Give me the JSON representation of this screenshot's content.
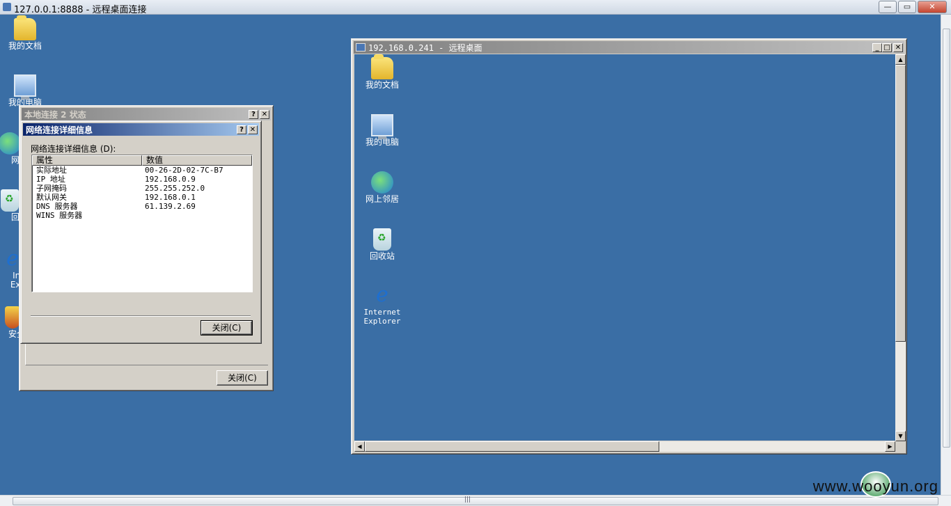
{
  "client": {
    "title": "127.0.0.1:8888 - 远程桌面连接",
    "controls": [
      "—",
      "▭",
      "✕"
    ]
  },
  "desktop_icons": [
    {
      "label": "我的文档",
      "icon": "folder-icon"
    },
    {
      "label": "我的电脑",
      "icon": "computer-icon"
    },
    {
      "label": "网",
      "icon": "network-icon"
    },
    {
      "label": "回",
      "icon": "recycle-bin-icon"
    },
    {
      "label": "Int",
      "label2": "Exp",
      "icon": "ie-icon"
    },
    {
      "label": "安全",
      "icon": "shield-icon"
    }
  ],
  "status_window": {
    "title": "本地连接 2 状态",
    "close_label": "关闭(C)"
  },
  "details_dialog": {
    "title": "网络连接详细信息",
    "group_label": "网络连接详细信息 (D):",
    "columns": [
      "属性",
      "数值"
    ],
    "rows": [
      {
        "name": "实际地址",
        "value": "00-26-2D-02-7C-B7"
      },
      {
        "name": "IP 地址",
        "value": "192.168.0.9"
      },
      {
        "name": "子网掩码",
        "value": "255.255.252.0"
      },
      {
        "name": "默认网关",
        "value": "192.168.0.1"
      },
      {
        "name": "DNS 服务器",
        "value": "61.139.2.69"
      },
      {
        "name": "WINS 服务器",
        "value": ""
      }
    ],
    "close_label": "关闭(C)"
  },
  "remote_window": {
    "title": "192.168.0.241 - 远程桌面",
    "icons": [
      {
        "label": "我的文档",
        "icon": "folder-icon"
      },
      {
        "label": "我的电脑",
        "icon": "computer-icon"
      },
      {
        "label": "网上邻居",
        "icon": "network-icon"
      },
      {
        "label": "回收站",
        "icon": "recycle-bin-icon"
      },
      {
        "label": "Internet",
        "label2": "Explorer",
        "icon": "ie-icon"
      }
    ]
  },
  "watermark": {
    "text": "www.wooyun.org"
  }
}
